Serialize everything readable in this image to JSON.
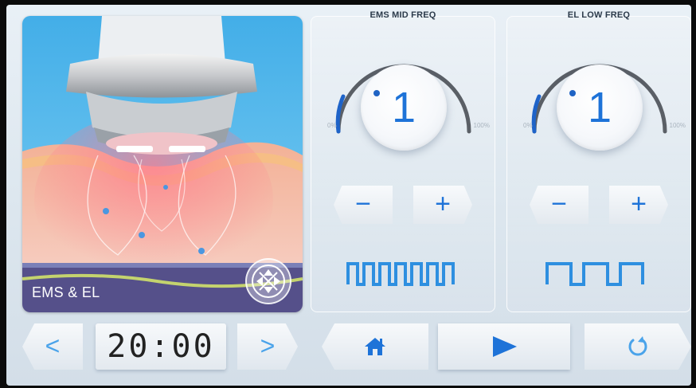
{
  "image_panel": {
    "label": "EMS & EL",
    "toggle_icon": "cross-arrows-icon"
  },
  "ems_panel": {
    "title": "EMS MID FREQ",
    "value": "1",
    "min_label": "0%",
    "max_label": "100%",
    "minus_label": "−",
    "plus_label": "+",
    "waveform": "high-frequency-square-wave-icon"
  },
  "el_panel": {
    "title": "EL LOW FREQ",
    "value": "1",
    "min_label": "0%",
    "max_label": "100%",
    "minus_label": "−",
    "plus_label": "+",
    "waveform": "low-frequency-square-wave-icon"
  },
  "bottom_bar": {
    "prev_label": "<",
    "next_label": ">",
    "timer": "20:00",
    "home_icon": "home-icon",
    "play_icon": "play-icon",
    "reset_icon": "reset-icon"
  },
  "colors": {
    "accent": "#1e73d8",
    "light_accent": "#4aa3ea",
    "dial_arc": "#5a5f66",
    "dial_arc_active": "#1e63c8"
  }
}
